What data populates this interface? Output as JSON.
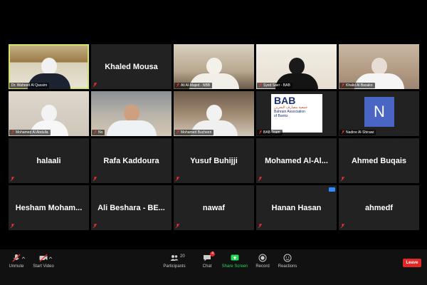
{
  "gallery": {
    "tiles": [
      {
        "type": "video",
        "label": "Dr. Waheed Al Qassim"
      },
      {
        "type": "name",
        "label": "Khaled Mousa"
      },
      {
        "type": "video",
        "label": "Ali Al-Majed - NBB"
      },
      {
        "type": "video",
        "label": "Syed Saer - BAB"
      },
      {
        "type": "video",
        "label": "Khalid Al Basako"
      },
      {
        "type": "video",
        "label": "Mohamed Al Abdulla"
      },
      {
        "type": "video",
        "label": "No"
      },
      {
        "type": "video",
        "label": "Mohamed Bucheeri"
      },
      {
        "type": "video",
        "label": "BAB Team"
      },
      {
        "type": "video",
        "label": "Nadine Al-Shirawi"
      },
      {
        "type": "name",
        "label": "halaali"
      },
      {
        "type": "name",
        "label": "Rafa Kaddoura"
      },
      {
        "type": "name",
        "label": "Yusuf Buhijji"
      },
      {
        "type": "name",
        "label": "Mohamed  Al-Al..."
      },
      {
        "type": "name",
        "label": "Ahmed Buqais"
      },
      {
        "type": "name",
        "label": "Hesham  Moham..."
      },
      {
        "type": "name",
        "label": "Ali Beshara - BE..."
      },
      {
        "type": "name",
        "label": "nawaf"
      },
      {
        "type": "name",
        "label": "Hanan Hasan"
      },
      {
        "type": "name",
        "label": "ahmedf"
      }
    ],
    "bab_logo": {
      "abbr": "BAB",
      "arabic": "جمعية مصارف البحرين",
      "english_1": "Bahrain Association",
      "english_2": "of Banks"
    },
    "avatar_letter": "N"
  },
  "toolbar": {
    "unmute": "Unmute",
    "start_video": "Start Video",
    "participants": "Participants",
    "participant_count": "20",
    "chat": "Chat",
    "chat_badge": "4",
    "share_screen": "Share Screen",
    "record": "Record",
    "reactions": "Reactions",
    "leave": "Leave"
  },
  "colors": {
    "accent": "#d6e36b",
    "leave": "#e02828",
    "share": "#23d959",
    "avatar": "#4a66c5"
  }
}
